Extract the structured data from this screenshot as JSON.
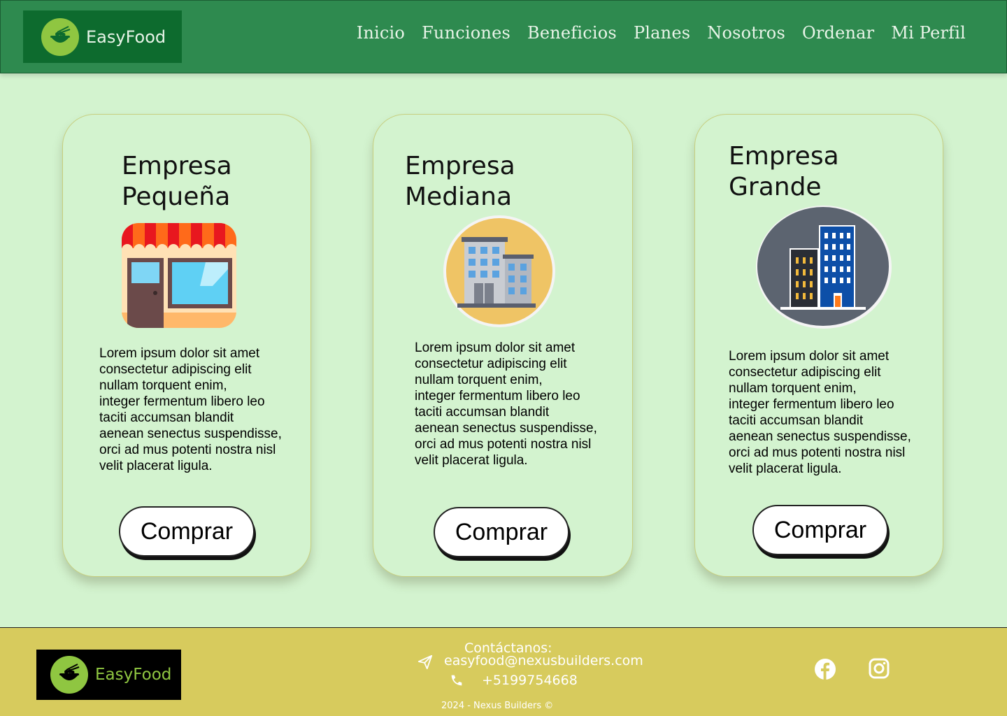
{
  "header": {
    "brand": "EasyFood",
    "nav": [
      "Inicio",
      "Funciones",
      "Beneficios",
      "Planes",
      "Nosotros",
      "Ordenar",
      "Mi Perfil"
    ]
  },
  "plans": [
    {
      "title_line1": "Empresa",
      "title_line2": "Pequeña",
      "description": "Lorem ipsum dolor sit amet\nconsectetur adipiscing elit\nnullam torquent enim,\ninteger fermentum libero leo\ntaciti accumsan blandit\naenean senectus suspendisse,\norci ad mus potenti nostra nisl\nvelit placerat ligula.",
      "button": "Comprar",
      "icon": "small-store-icon"
    },
    {
      "title_line1": "Empresa",
      "title_line2": "Mediana",
      "description": "Lorem ipsum dolor sit amet\nconsectetur adipiscing elit\nnullam torquent enim,\ninteger fermentum libero leo\ntaciti accumsan blandit\naenean senectus suspendisse,\norci ad mus potenti nostra nisl\nvelit placerat ligula.",
      "button": "Comprar",
      "icon": "office-building-icon"
    },
    {
      "title_line1": "Empresa",
      "title_line2": "Grande",
      "description": "Lorem ipsum dolor sit amet\nconsectetur adipiscing elit\nnullam torquent enim,\ninteger fermentum libero leo\ntaciti accumsan blandit\naenean senectus suspendisse,\norci ad mus potenti nostra nisl\nvelit placerat ligula.",
      "button": "Comprar",
      "icon": "skyscraper-icon"
    }
  ],
  "footer": {
    "brand": "EasyFood",
    "contact_title": "Contáctanos:",
    "email": "easyfood@nexusbuilders.com",
    "phone": "+5199754668",
    "copyright": "2024 - Nexus Builders ©",
    "social_icons": [
      "facebook-icon",
      "instagram-icon"
    ]
  },
  "colors": {
    "header_bg": "#2e8a4f",
    "page_bg": "#d3f3cf",
    "footer_bg": "#d7cb5d",
    "logo_green": "#8fc641"
  }
}
